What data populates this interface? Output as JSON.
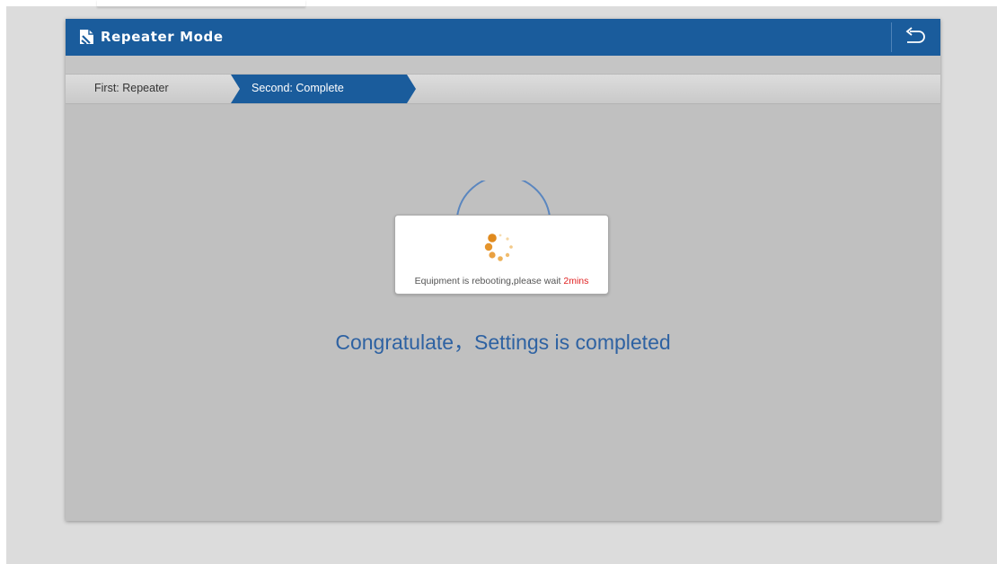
{
  "window": {
    "title": "Repeater Mode",
    "title_icon": "page-corner-icon",
    "back_icon": "return-arrow-icon"
  },
  "steps": {
    "first": "First: Repeater",
    "second": "Second: Complete",
    "active": "second"
  },
  "main": {
    "message": "Congratulate，Settings is completed"
  },
  "dialog": {
    "spinner_icon": "loading-spinner-icon",
    "message": "Equipment is rebooting,please wait ",
    "wait_time": "2mins"
  },
  "colors": {
    "titlebar": "#1a5c9c",
    "active_step": "#1a5c9c",
    "message_text": "#2e62a2",
    "wait_time": "#e02020",
    "spinner": "#e08a1e"
  }
}
